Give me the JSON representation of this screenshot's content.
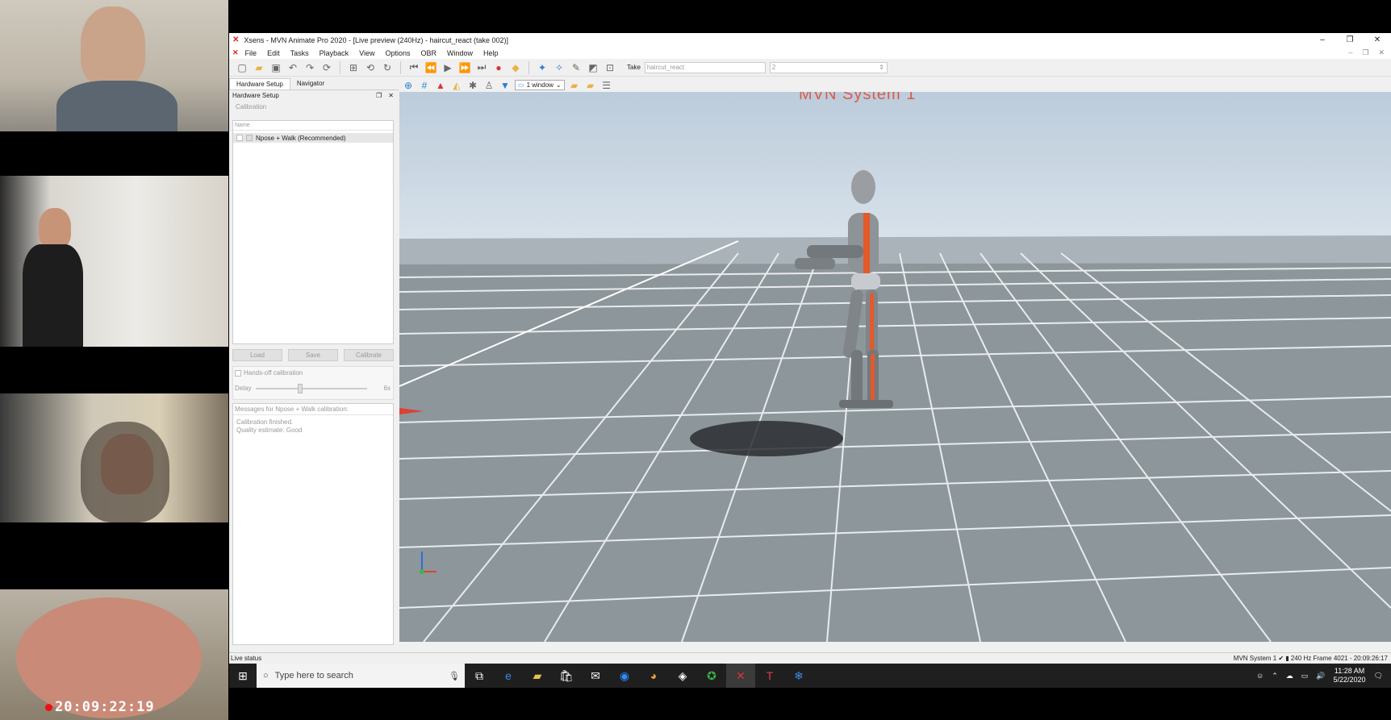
{
  "window": {
    "title": "Xsens - MVN Animate Pro 2020 - [Live preview (240Hz) - haircut_react (take 002)]",
    "controls": [
      "–",
      "❐",
      "✕"
    ]
  },
  "menu": [
    "File",
    "Edit",
    "Tasks",
    "Playback",
    "View",
    "Options",
    "OBR",
    "Window",
    "Help"
  ],
  "toolbar": {
    "take_label": "Take",
    "take_name": "haircut_react",
    "take_number": "2"
  },
  "panel": {
    "tabs": [
      "Hardware Setup",
      "Navigator"
    ],
    "title": "Hardware Setup",
    "subtab": "Calibration",
    "list_header": "Name",
    "list_item": "Npose + Walk (Recommended)",
    "buttons": {
      "load": "Load",
      "save": "Save",
      "calibrate": "Calibrate"
    },
    "handsoff_label": "Hands-off calibration",
    "delay_label": "Delay",
    "delay_value": "6s",
    "messages_header": "Messages for Npose + Walk calibration:",
    "messages": [
      "Calibration finished.",
      "Quality estimate: Good"
    ]
  },
  "viewport": {
    "window_select": "1 window",
    "label": "MVN System 1"
  },
  "status": {
    "left": "Live status",
    "right": "MVN System 1 ✔ ▮ 240 Hz  Frame 4021 - 20:09:26:17"
  },
  "taskbar": {
    "search_placeholder": "Type here to search",
    "time": "11:28 AM",
    "date": "5/22/2020"
  },
  "video": {
    "timecode": "20:09:22:19"
  }
}
